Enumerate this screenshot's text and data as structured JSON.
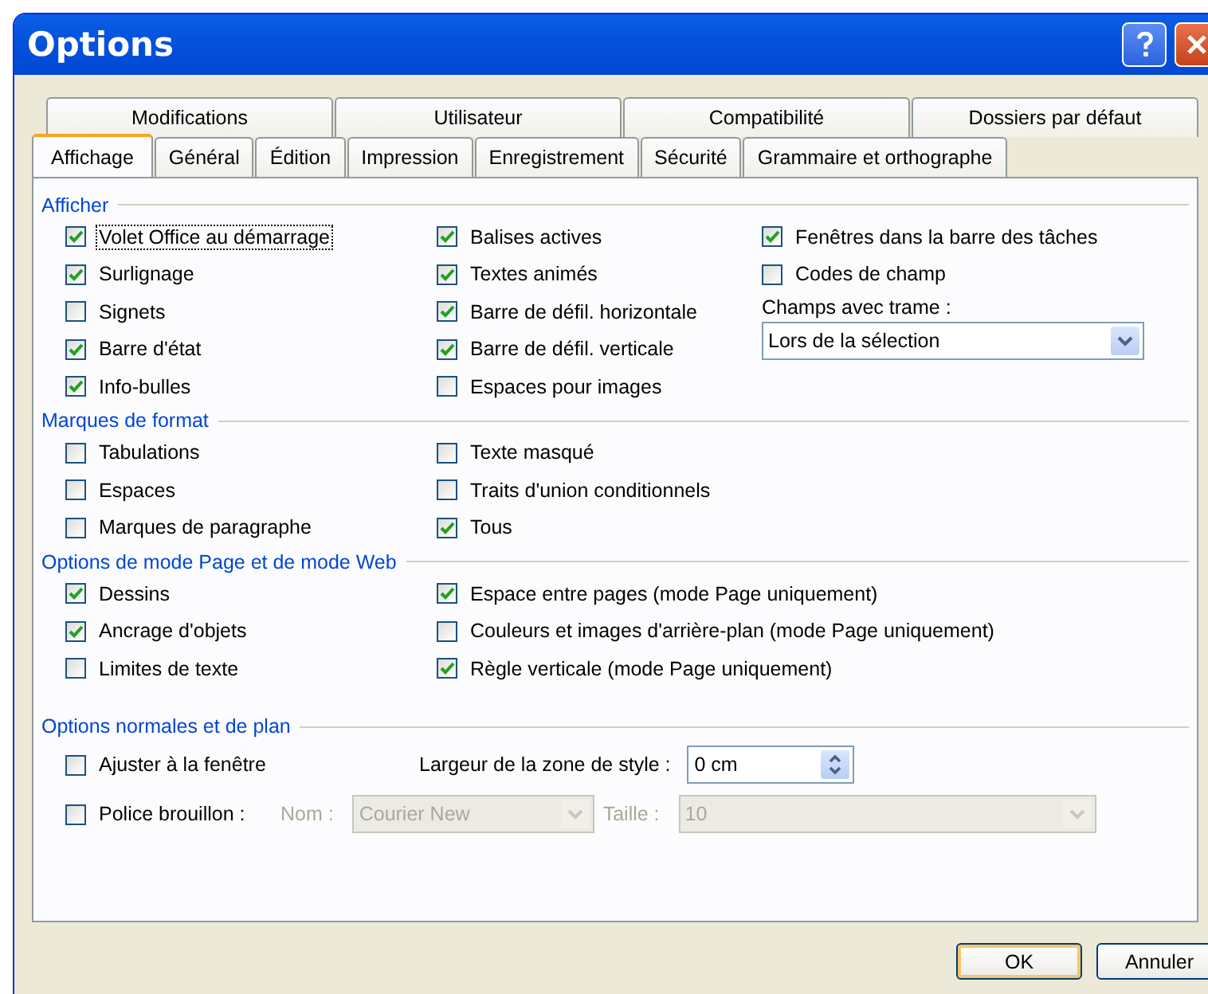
{
  "window": {
    "title": "Options"
  },
  "tab_rows": [
    [
      {
        "label": "Modifications",
        "selected": false
      },
      {
        "label": "Utilisateur",
        "selected": false
      },
      {
        "label": "Compatibilité",
        "selected": false
      },
      {
        "label": "Dossiers par défaut",
        "selected": false
      }
    ],
    [
      {
        "label": "Affichage",
        "selected": true
      },
      {
        "label": "Général",
        "selected": false
      },
      {
        "label": "Édition",
        "selected": false
      },
      {
        "label": "Impression",
        "selected": false
      },
      {
        "label": "Enregistrement",
        "selected": false
      },
      {
        "label": "Sécurité",
        "selected": false
      },
      {
        "label": "Grammaire et orthographe",
        "selected": false
      }
    ]
  ],
  "sections": [
    {
      "title": "Afficher",
      "columns": [
        [
          {
            "kind": "checkbox",
            "label": "Volet Office au démarrage",
            "checked": true,
            "focused": true
          },
          {
            "kind": "checkbox",
            "label": "Surlignage",
            "checked": true
          },
          {
            "kind": "checkbox",
            "label": "Signets",
            "checked": false
          },
          {
            "kind": "checkbox",
            "label": "Barre d'état",
            "checked": true
          },
          {
            "kind": "checkbox",
            "label": "Info-bulles",
            "checked": true
          }
        ],
        [
          {
            "kind": "checkbox",
            "label": "Balises actives",
            "checked": true
          },
          {
            "kind": "checkbox",
            "label": "Textes animés",
            "checked": true
          },
          {
            "kind": "checkbox",
            "label": "Barre de défil. horizontale",
            "checked": true
          },
          {
            "kind": "checkbox",
            "label": "Barre de défil. verticale",
            "checked": true
          },
          {
            "kind": "checkbox",
            "label": "Espaces pour images",
            "checked": false
          }
        ],
        [
          {
            "kind": "checkbox",
            "label": "Fenêtres dans la barre des tâches",
            "checked": true
          },
          {
            "kind": "checkbox",
            "label": "Codes de champ",
            "checked": false
          },
          {
            "kind": "label",
            "label": "Champs avec trame :"
          },
          {
            "kind": "dropdown",
            "value": "Lors de la sélection"
          }
        ]
      ]
    },
    {
      "title": "Marques de format",
      "columns": [
        [
          {
            "kind": "checkbox",
            "label": "Tabulations",
            "checked": false
          },
          {
            "kind": "checkbox",
            "label": "Espaces",
            "checked": false
          },
          {
            "kind": "checkbox",
            "label": "Marques de paragraphe",
            "checked": false
          }
        ],
        [
          {
            "kind": "checkbox",
            "label": "Texte masqué",
            "checked": false
          },
          {
            "kind": "checkbox",
            "label": "Traits d'union conditionnels",
            "checked": false
          },
          {
            "kind": "checkbox",
            "label": "Tous",
            "checked": true
          }
        ]
      ]
    },
    {
      "title": "Options de mode Page et de mode Web",
      "columns": [
        [
          {
            "kind": "checkbox",
            "label": "Dessins",
            "checked": true
          },
          {
            "kind": "checkbox",
            "label": "Ancrage d'objets",
            "checked": true
          },
          {
            "kind": "checkbox",
            "label": "Limites de texte",
            "checked": false
          }
        ],
        [
          {
            "kind": "checkbox",
            "label": "Espace entre pages (mode Page uniquement)",
            "checked": true
          },
          {
            "kind": "checkbox",
            "label": "Couleurs et images d'arrière-plan (mode Page uniquement)",
            "checked": false
          },
          {
            "kind": "checkbox",
            "label": "Règle verticale (mode Page uniquement)",
            "checked": true
          }
        ]
      ]
    }
  ],
  "normal_options": {
    "title": "Options normales et de plan",
    "fit_window": {
      "label": "Ajuster à la fenêtre",
      "checked": false
    },
    "style_area_width": {
      "label": "Largeur de la zone de style :",
      "value": "0 cm"
    },
    "draft_font": {
      "label": "Police brouillon :",
      "checked": false
    },
    "font_name": {
      "label": "Nom :",
      "value": "Courier New",
      "disabled": true
    },
    "font_size": {
      "label": "Taille :",
      "value": "10",
      "disabled": true
    }
  },
  "buttons": [
    {
      "label": "OK",
      "default": true
    },
    {
      "label": "Annuler",
      "default": false
    }
  ]
}
